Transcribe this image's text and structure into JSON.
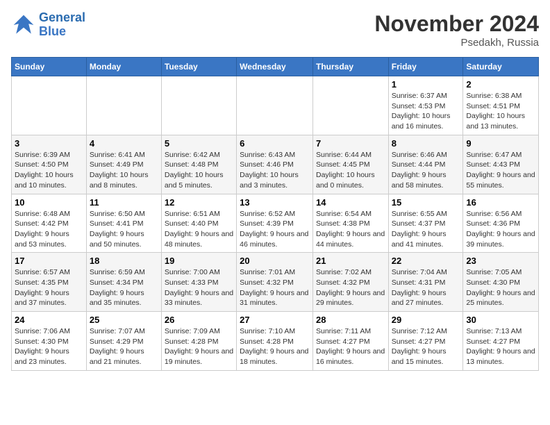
{
  "logo": {
    "line1": "General",
    "line2": "Blue"
  },
  "title": "November 2024",
  "subtitle": "Psedakh, Russia",
  "weekdays": [
    "Sunday",
    "Monday",
    "Tuesday",
    "Wednesday",
    "Thursday",
    "Friday",
    "Saturday"
  ],
  "weeks": [
    [
      {
        "day": "",
        "info": ""
      },
      {
        "day": "",
        "info": ""
      },
      {
        "day": "",
        "info": ""
      },
      {
        "day": "",
        "info": ""
      },
      {
        "day": "",
        "info": ""
      },
      {
        "day": "1",
        "info": "Sunrise: 6:37 AM\nSunset: 4:53 PM\nDaylight: 10 hours and 16 minutes."
      },
      {
        "day": "2",
        "info": "Sunrise: 6:38 AM\nSunset: 4:51 PM\nDaylight: 10 hours and 13 minutes."
      }
    ],
    [
      {
        "day": "3",
        "info": "Sunrise: 6:39 AM\nSunset: 4:50 PM\nDaylight: 10 hours and 10 minutes."
      },
      {
        "day": "4",
        "info": "Sunrise: 6:41 AM\nSunset: 4:49 PM\nDaylight: 10 hours and 8 minutes."
      },
      {
        "day": "5",
        "info": "Sunrise: 6:42 AM\nSunset: 4:48 PM\nDaylight: 10 hours and 5 minutes."
      },
      {
        "day": "6",
        "info": "Sunrise: 6:43 AM\nSunset: 4:46 PM\nDaylight: 10 hours and 3 minutes."
      },
      {
        "day": "7",
        "info": "Sunrise: 6:44 AM\nSunset: 4:45 PM\nDaylight: 10 hours and 0 minutes."
      },
      {
        "day": "8",
        "info": "Sunrise: 6:46 AM\nSunset: 4:44 PM\nDaylight: 9 hours and 58 minutes."
      },
      {
        "day": "9",
        "info": "Sunrise: 6:47 AM\nSunset: 4:43 PM\nDaylight: 9 hours and 55 minutes."
      }
    ],
    [
      {
        "day": "10",
        "info": "Sunrise: 6:48 AM\nSunset: 4:42 PM\nDaylight: 9 hours and 53 minutes."
      },
      {
        "day": "11",
        "info": "Sunrise: 6:50 AM\nSunset: 4:41 PM\nDaylight: 9 hours and 50 minutes."
      },
      {
        "day": "12",
        "info": "Sunrise: 6:51 AM\nSunset: 4:40 PM\nDaylight: 9 hours and 48 minutes."
      },
      {
        "day": "13",
        "info": "Sunrise: 6:52 AM\nSunset: 4:39 PM\nDaylight: 9 hours and 46 minutes."
      },
      {
        "day": "14",
        "info": "Sunrise: 6:54 AM\nSunset: 4:38 PM\nDaylight: 9 hours and 44 minutes."
      },
      {
        "day": "15",
        "info": "Sunrise: 6:55 AM\nSunset: 4:37 PM\nDaylight: 9 hours and 41 minutes."
      },
      {
        "day": "16",
        "info": "Sunrise: 6:56 AM\nSunset: 4:36 PM\nDaylight: 9 hours and 39 minutes."
      }
    ],
    [
      {
        "day": "17",
        "info": "Sunrise: 6:57 AM\nSunset: 4:35 PM\nDaylight: 9 hours and 37 minutes."
      },
      {
        "day": "18",
        "info": "Sunrise: 6:59 AM\nSunset: 4:34 PM\nDaylight: 9 hours and 35 minutes."
      },
      {
        "day": "19",
        "info": "Sunrise: 7:00 AM\nSunset: 4:33 PM\nDaylight: 9 hours and 33 minutes."
      },
      {
        "day": "20",
        "info": "Sunrise: 7:01 AM\nSunset: 4:32 PM\nDaylight: 9 hours and 31 minutes."
      },
      {
        "day": "21",
        "info": "Sunrise: 7:02 AM\nSunset: 4:32 PM\nDaylight: 9 hours and 29 minutes."
      },
      {
        "day": "22",
        "info": "Sunrise: 7:04 AM\nSunset: 4:31 PM\nDaylight: 9 hours and 27 minutes."
      },
      {
        "day": "23",
        "info": "Sunrise: 7:05 AM\nSunset: 4:30 PM\nDaylight: 9 hours and 25 minutes."
      }
    ],
    [
      {
        "day": "24",
        "info": "Sunrise: 7:06 AM\nSunset: 4:30 PM\nDaylight: 9 hours and 23 minutes."
      },
      {
        "day": "25",
        "info": "Sunrise: 7:07 AM\nSunset: 4:29 PM\nDaylight: 9 hours and 21 minutes."
      },
      {
        "day": "26",
        "info": "Sunrise: 7:09 AM\nSunset: 4:28 PM\nDaylight: 9 hours and 19 minutes."
      },
      {
        "day": "27",
        "info": "Sunrise: 7:10 AM\nSunset: 4:28 PM\nDaylight: 9 hours and 18 minutes."
      },
      {
        "day": "28",
        "info": "Sunrise: 7:11 AM\nSunset: 4:27 PM\nDaylight: 9 hours and 16 minutes."
      },
      {
        "day": "29",
        "info": "Sunrise: 7:12 AM\nSunset: 4:27 PM\nDaylight: 9 hours and 15 minutes."
      },
      {
        "day": "30",
        "info": "Sunrise: 7:13 AM\nSunset: 4:27 PM\nDaylight: 9 hours and 13 minutes."
      }
    ]
  ]
}
